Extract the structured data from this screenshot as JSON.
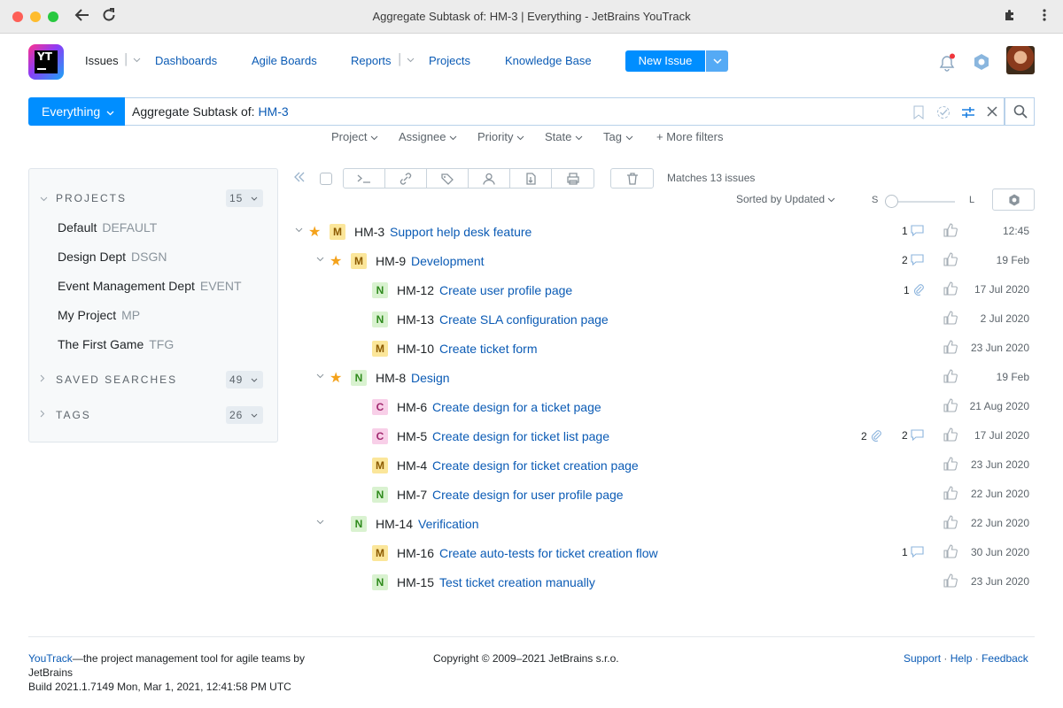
{
  "window": {
    "title": "Aggregate Subtask of: HM-3 | Everything - JetBrains YouTrack"
  },
  "icons": {
    "back": "back-arrow-icon",
    "reload": "reload-icon",
    "extensions": "puzzle-icon",
    "menu": "kebab-menu-icon"
  },
  "header": {
    "logo_text": "YT",
    "nav": [
      "Issues",
      "Dashboards",
      "Agile Boards",
      "Reports",
      "Projects",
      "Knowledge Base"
    ],
    "new_issue": "New Issue"
  },
  "search": {
    "scope": "Everything",
    "query_label": "Aggregate Subtask of:",
    "query_value": "HM-3"
  },
  "filters": [
    "Project",
    "Assignee",
    "Priority",
    "State",
    "Tag",
    "+ More filters"
  ],
  "sidebar": {
    "projects_label": "PROJECTS",
    "projects_count": "15",
    "projects": [
      {
        "name": "Default",
        "key": "DEFAULT"
      },
      {
        "name": "Design Dept",
        "key": "DSGN"
      },
      {
        "name": "Event Management Dept",
        "key": "EVENT"
      },
      {
        "name": "My Project",
        "key": "MP"
      },
      {
        "name": "The First Game",
        "key": "TFG"
      }
    ],
    "saved_label": "SAVED SEARCHES",
    "saved_count": "49",
    "tags_label": "TAGS",
    "tags_count": "26"
  },
  "toolbar": {
    "matches": "Matches 13 issues",
    "sorted": "Sorted by Updated",
    "size_s": "S",
    "size_l": "L"
  },
  "issues": [
    {
      "id": "HM-3",
      "summary": "Support help desk feature",
      "priority": "M",
      "starred": true,
      "expanded": true,
      "comments": "1",
      "attachments": "",
      "date": "12:45"
    },
    {
      "id": "HM-9",
      "summary": "Development",
      "priority": "M",
      "starred": true,
      "expanded": true,
      "comments": "2",
      "attachments": "",
      "date": "19 Feb"
    },
    {
      "id": "HM-12",
      "summary": "Create user profile page",
      "priority": "N",
      "starred": false,
      "comments": "",
      "attachments": "1",
      "date": "17 Jul 2020"
    },
    {
      "id": "HM-13",
      "summary": "Create SLA configuration page",
      "priority": "N",
      "starred": false,
      "comments": "",
      "attachments": "",
      "date": "2 Jul 2020"
    },
    {
      "id": "HM-10",
      "summary": "Create ticket form",
      "priority": "M",
      "starred": false,
      "comments": "",
      "attachments": "",
      "date": "23 Jun 2020"
    },
    {
      "id": "HM-8",
      "summary": "Design",
      "priority": "N",
      "starred": true,
      "expanded": true,
      "comments": "",
      "attachments": "",
      "date": "19 Feb"
    },
    {
      "id": "HM-6",
      "summary": "Create design for a ticket page",
      "priority": "C",
      "starred": false,
      "comments": "",
      "attachments": "",
      "date": "21 Aug 2020"
    },
    {
      "id": "HM-5",
      "summary": "Create design for ticket list page",
      "priority": "C",
      "starred": false,
      "comments": "2",
      "attachments": "2",
      "date": "17 Jul 2020"
    },
    {
      "id": "HM-4",
      "summary": "Create design for ticket creation page",
      "priority": "M",
      "starred": false,
      "comments": "",
      "attachments": "",
      "date": "23 Jun 2020"
    },
    {
      "id": "HM-7",
      "summary": "Create design for user profile page",
      "priority": "N",
      "starred": false,
      "comments": "",
      "attachments": "",
      "date": "22 Jun 2020"
    },
    {
      "id": "HM-14",
      "summary": "Verification",
      "priority": "N",
      "starred": false,
      "expanded": true,
      "comments": "",
      "attachments": "",
      "date": "22 Jun 2020"
    },
    {
      "id": "HM-16",
      "summary": "Create auto-tests for ticket creation flow",
      "priority": "M",
      "starred": false,
      "comments": "1",
      "attachments": "",
      "date": "30 Jun 2020"
    },
    {
      "id": "HM-15",
      "summary": "Test ticket creation manually",
      "priority": "N",
      "starred": false,
      "comments": "",
      "attachments": "",
      "date": "23 Jun 2020"
    }
  ],
  "footer": {
    "youtrack_link": "YouTrack",
    "tagline_1": "—the project management tool for agile teams by",
    "tagline_2": "JetBrains",
    "build": "Build 2021.1.7149 Mon, Mar 1, 2021, 12:41:58 PM UTC",
    "copyright": "Copyright © 2009–2021 JetBrains s.r.o.",
    "support": "Support",
    "help": "Help",
    "feedback": "Feedback",
    "sep": "·"
  },
  "colors": {
    "accent": "#008eff",
    "link": "#0b5bb5",
    "star": "#f4a21b"
  }
}
